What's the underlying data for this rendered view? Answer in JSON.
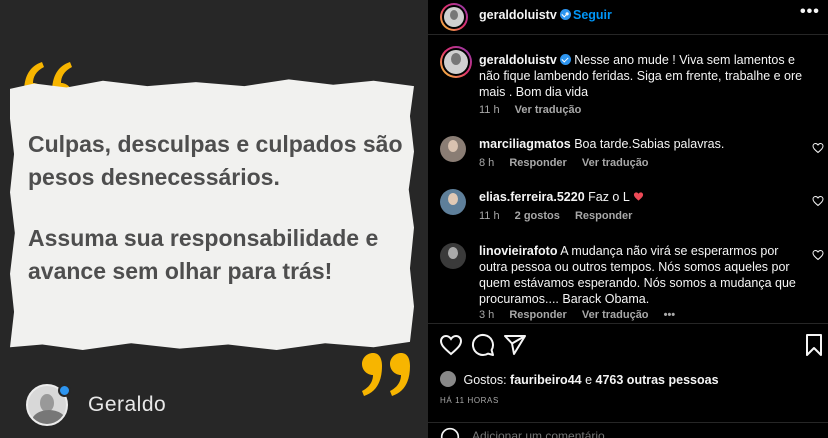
{
  "post_image": {
    "quote_lines": [
      "Culpas, desculpas e culpados são pesos desnecessários.",
      "Assuma sua responsabilidade e avance sem olhar para trás!"
    ],
    "author_name": "Geraldo",
    "accent_color": "#f7b500",
    "background_color": "#272727"
  },
  "header": {
    "username": "geraldoluistv",
    "dot": "•",
    "follow_label": "Seguir",
    "more_icon": "more-horizontal-icon"
  },
  "caption": {
    "username": "geraldoluistv",
    "text": "Nesse ano mude ! Viva sem lamentos e não fique lambendo feridas. Siga em frente, trabalhe e ore mais . Bom dia vida",
    "time": "11 h",
    "translate": "Ver tradução"
  },
  "comments": [
    {
      "username": "marciliagmatos",
      "text": "Boa tarde.Sabias palavras.",
      "time": "8 h",
      "likes": "",
      "reply": "Responder",
      "translate": "Ver tradução"
    },
    {
      "username": "elias.ferreira.5220",
      "text": "Faz o L",
      "time": "11 h",
      "likes": "2 gostos",
      "reply": "Responder",
      "translate": ""
    },
    {
      "username": "linovieirafoto",
      "text": "A mudança não virá se esperarmos por outra pessoa ou outros tempos. Nós somos aqueles por quem estávamos esperando. Nós somos a mudança que procuramos.... Barack Obama.",
      "time": "3 h",
      "likes": "",
      "reply": "Responder",
      "translate": "Ver tradução",
      "more": "•••"
    }
  ],
  "actions": {
    "icons": [
      "heart-icon",
      "comment-icon",
      "share-icon",
      "bookmark-icon"
    ]
  },
  "likes": {
    "prefix": "Gostos:",
    "first_user": "fauribeiro44",
    "connector": "e",
    "others": "4763 outras pessoas"
  },
  "date": "HÁ 11 HORAS",
  "comment_input": {
    "placeholder": "Adicionar um comentário..."
  },
  "colors": {
    "link_blue": "#0095f6",
    "verified_blue": "#2d95f0",
    "heart_red": "#ed4956"
  }
}
